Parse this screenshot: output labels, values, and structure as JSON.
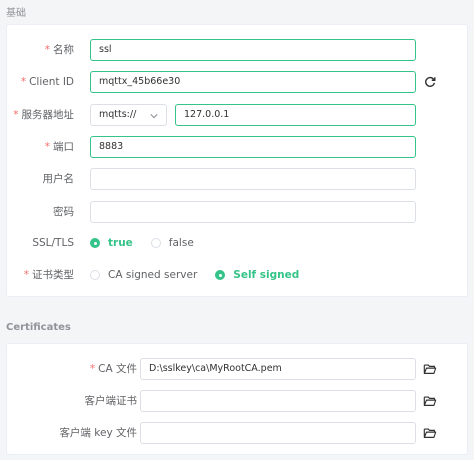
{
  "sections": {
    "basic_title": "基础",
    "certs_title": "Certificates"
  },
  "form": {
    "name": {
      "label": "名称",
      "value": "ssl",
      "required": true
    },
    "client_id": {
      "label": "Client ID",
      "value": "mqttx_45b66e30",
      "required": true,
      "refresh_icon": "refresh-icon"
    },
    "host": {
      "label": "服务器地址",
      "protocol": "mqtts://",
      "value": "127.0.0.1",
      "required": true
    },
    "port": {
      "label": "端口",
      "value": "8883",
      "required": true
    },
    "username": {
      "label": "用户名",
      "value": ""
    },
    "password": {
      "label": "密码",
      "value": ""
    },
    "ssl_tls": {
      "label": "SSL/TLS",
      "options": [
        "true",
        "false"
      ],
      "selected": "true"
    },
    "cert_type": {
      "label": "证书类型",
      "options": [
        "CA signed server",
        "Self signed"
      ],
      "selected": "Self signed",
      "required": true
    }
  },
  "certificates": {
    "ca_file": {
      "label": "CA 文件",
      "value": "D:\\sslkey\\ca\\MyRootCA.pem",
      "required": true
    },
    "client_cert": {
      "label": "客户端证书",
      "value": ""
    },
    "client_key": {
      "label": "客户端 key 文件",
      "value": ""
    }
  },
  "colors": {
    "accent": "#34c388",
    "required": "#f56c6c",
    "background": "#f4f5f7"
  }
}
